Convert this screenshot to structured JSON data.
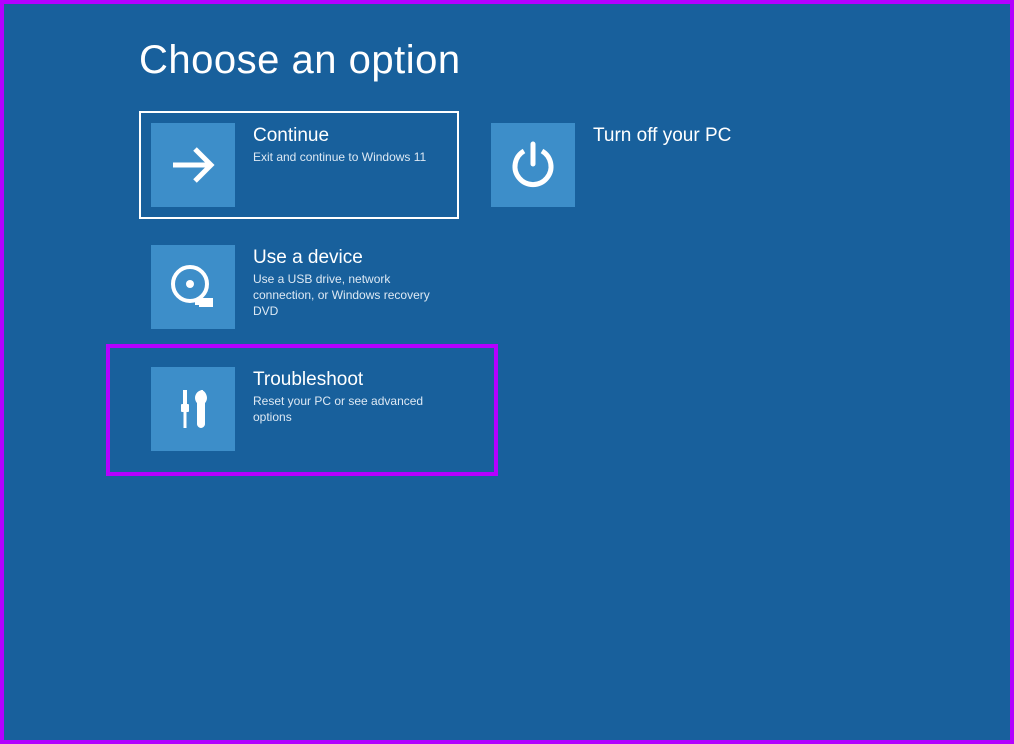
{
  "page": {
    "title": "Choose an option"
  },
  "options": {
    "continue": {
      "title": "Continue",
      "desc": "Exit and continue to Windows 11"
    },
    "power": {
      "title": "Turn off your PC",
      "desc": ""
    },
    "device": {
      "title": "Use a device",
      "desc": "Use a USB drive, network connection, or Windows recovery DVD"
    },
    "troubleshoot": {
      "title": "Troubleshoot",
      "desc": "Reset your PC or see advanced options"
    }
  },
  "colors": {
    "background": "#18609c",
    "tile": "#3d8ec9",
    "highlight": "#b400ff",
    "selected_border": "#ffffff"
  }
}
